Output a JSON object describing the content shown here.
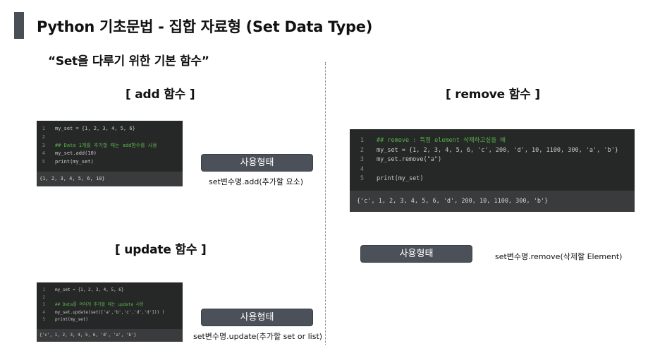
{
  "header": {
    "title": "Python 기초문법 - 집합 자료형 (Set Data Type)",
    "subtitle": "“Set을 다루기 위한 기본 함수”"
  },
  "add": {
    "heading": "[ add 함수 ]",
    "code": [
      {
        "n": "1",
        "text": "my_set = {1, 2, 3, 4, 5, 6}",
        "comment": false
      },
      {
        "n": "2",
        "text": "",
        "comment": false
      },
      {
        "n": "3",
        "text": "## Data 1개를 추가할 때는 add함수를 사용",
        "comment": true
      },
      {
        "n": "4",
        "text": "my_set.add(10)",
        "comment": false
      },
      {
        "n": "5",
        "text": "print(my_set)",
        "comment": false
      }
    ],
    "output": "{1, 2, 3, 4, 5, 6, 10}",
    "button_label": "사용형태",
    "usage": "set변수명.add(추가할 요소)"
  },
  "update": {
    "heading": "[ update 함수 ]",
    "code": [
      {
        "n": "1",
        "text": "my_set = {1, 2, 3, 4, 5, 6}",
        "comment": false
      },
      {
        "n": "2",
        "text": "",
        "comment": false
      },
      {
        "n": "3",
        "text": "## Data를 여러개 추가할 때는 update 사용",
        "comment": true
      },
      {
        "n": "4",
        "text": "my_set.update(set(['a','b','c','d','d'])) )",
        "comment": false
      },
      {
        "n": "5",
        "text": "print(my_set)",
        "comment": false
      }
    ],
    "output": "{'c', 1, 2, 3, 4, 5, 6, 'd', 'a', 'b'}",
    "button_label": "사용형태",
    "usage": "set변수명.update(추가할 set or list)"
  },
  "remove": {
    "heading": "[ remove 함수 ]",
    "code": [
      {
        "n": "1",
        "text": "## remove : 특정 element 삭제하고싶을 때",
        "comment": true
      },
      {
        "n": "2",
        "text": "my_set = {1, 2, 3, 4, 5, 6, 'c', 200, 'd', 10, 1100, 300, 'a', 'b'}",
        "comment": false
      },
      {
        "n": "3",
        "text": "my_set.remove(\"a\")",
        "comment": false
      },
      {
        "n": "4",
        "text": "",
        "comment": false
      },
      {
        "n": "5",
        "text": "print(my_set)",
        "comment": false
      }
    ],
    "output": "{'c', 1, 2, 3, 4, 5, 6, 'd', 200, 10, 1100, 300, 'b'}",
    "button_label": "사용형태",
    "usage": "set변수명.remove(삭제할 Element)"
  }
}
